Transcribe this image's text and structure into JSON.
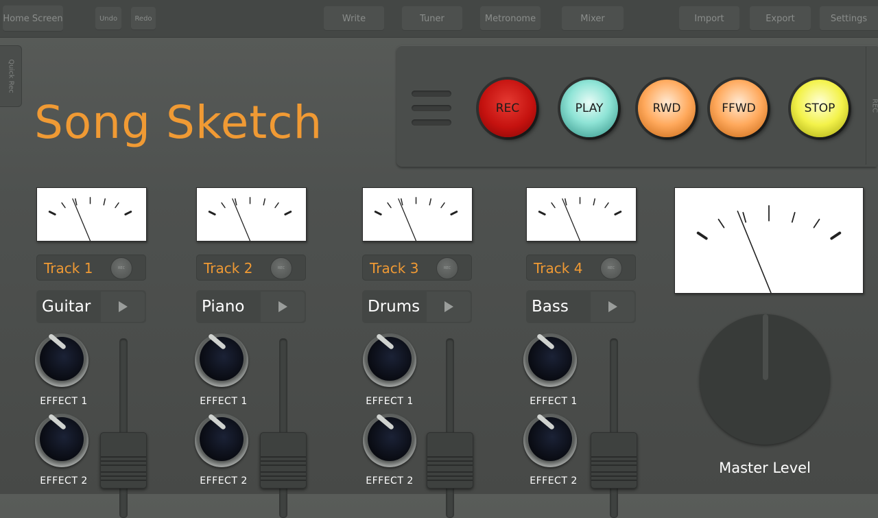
{
  "topbar": {
    "home": "Home Screen",
    "undo": "Undo",
    "redo": "Redo",
    "write": "Write",
    "tuner": "Tuner",
    "metronome": "Metronome",
    "mixer": "Mixer",
    "import": "Import",
    "export": "Export",
    "settings": "Settings"
  },
  "side": {
    "quick_rec": "Quick Rec",
    "right_tab": "REC"
  },
  "app": {
    "title": "Song Sketch"
  },
  "transport": {
    "rec": "REC",
    "play": "PLAY",
    "rwd": "RWD",
    "ffwd": "FFWD",
    "stop": "STOP",
    "colors": {
      "rec": "#c5120f",
      "play": "#8fe4d6",
      "rwd": "#ffa95c",
      "ffwd": "#ffa95c",
      "stop": "#f3f24a"
    }
  },
  "tracks": [
    {
      "label": "Track 1",
      "rec": "REC",
      "instrument": "Guitar",
      "effect1": "EFFECT 1",
      "effect2": "EFFECT 2"
    },
    {
      "label": "Track 2",
      "rec": "REC",
      "instrument": "Piano",
      "effect1": "EFFECT 1",
      "effect2": "EFFECT 2"
    },
    {
      "label": "Track 3",
      "rec": "REC",
      "instrument": "Drums",
      "effect1": "EFFECT 1",
      "effect2": "EFFECT 2"
    },
    {
      "label": "Track 4",
      "rec": "REC",
      "instrument": "Bass",
      "effect1": "EFFECT 1",
      "effect2": "EFFECT 2"
    }
  ],
  "master": {
    "label": "Master Level"
  },
  "accent_color": "#f09a34"
}
